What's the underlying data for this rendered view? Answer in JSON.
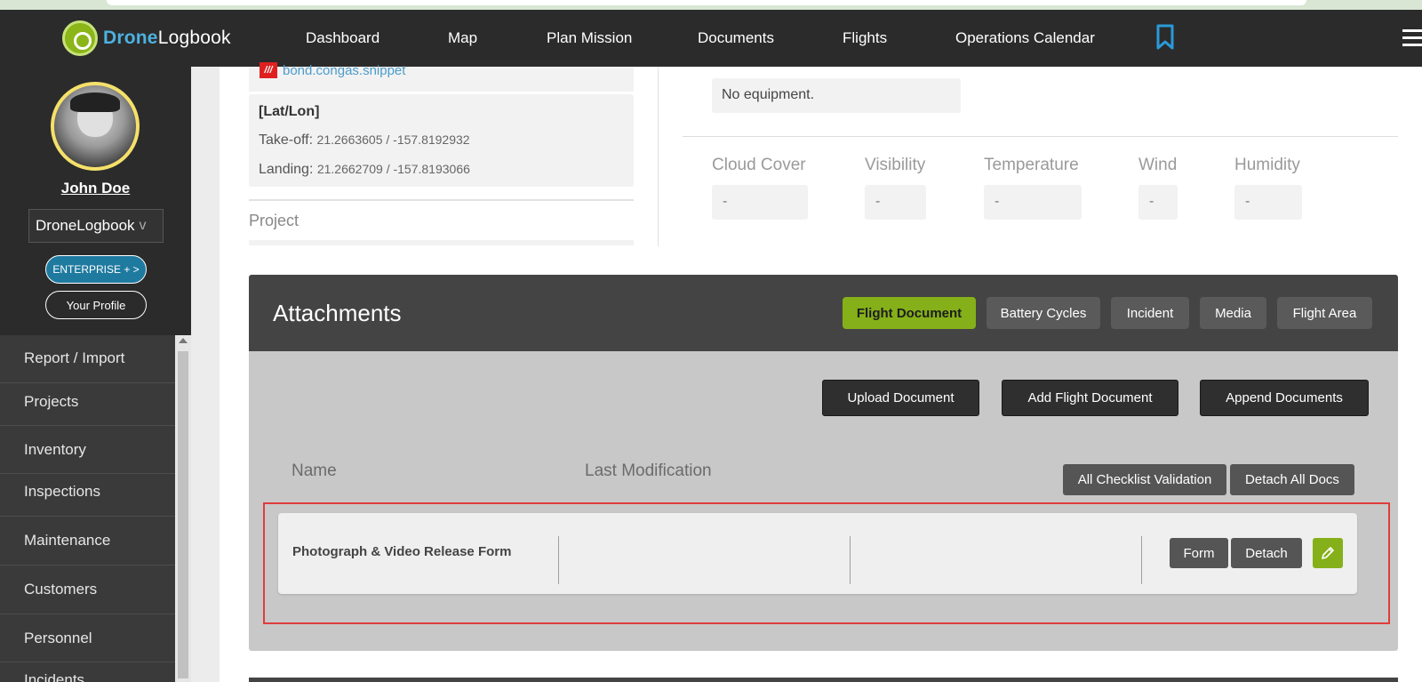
{
  "app": {
    "logo_part1": "Drone",
    "logo_part2": "Logbook"
  },
  "nav": {
    "items": [
      "Dashboard",
      "Map",
      "Plan Mission",
      "Documents",
      "Flights",
      "Operations Calendar"
    ]
  },
  "user": {
    "name": "John Doe",
    "org": "DroneLogbook",
    "org_chevron": "v",
    "enterprise_label": "ENTERPRISE + >",
    "profile_label": "Your Profile"
  },
  "sidebar": {
    "items": [
      "Report / Import",
      "Projects",
      "Inventory",
      "Inspections",
      "Maintenance",
      "Customers",
      "Personnel",
      "Incidents"
    ]
  },
  "flight": {
    "file_icon": "///",
    "file_name": "bond.congas.snippet",
    "latlon_title": "[Lat/Lon]",
    "takeoff_label": "Take-off:",
    "takeoff_value": "21.2663605 / -157.8192932",
    "landing_label": "Landing:",
    "landing_value": "21.2662709 / -157.8193066",
    "project_label": "Project",
    "equipment": "No equipment."
  },
  "weather": {
    "cloud_cover": {
      "label": "Cloud Cover",
      "value": "-"
    },
    "visibility": {
      "label": "Visibility",
      "value": "-"
    },
    "temperature": {
      "label": "Temperature",
      "value": "-"
    },
    "wind": {
      "label": "Wind",
      "value": "-"
    },
    "humidity": {
      "label": "Humidity",
      "value": "-"
    }
  },
  "attachments": {
    "title": "Attachments",
    "tabs": [
      "Flight Document",
      "Battery Cycles",
      "Incident",
      "Media",
      "Flight Area"
    ],
    "active_tab": "Flight Document",
    "actions": {
      "upload": "Upload Document",
      "add": "Add Flight Document",
      "append": "Append Documents"
    },
    "columns": {
      "name": "Name",
      "last_mod": "Last Modification"
    },
    "bulk": {
      "validate": "All Checklist Validation",
      "detach_all": "Detach All Docs"
    },
    "rows": [
      {
        "name": "Photograph & Video Release Form",
        "form_label": "Form",
        "detach_label": "Detach"
      }
    ]
  },
  "colors": {
    "nav_bg": "#2b2b2b",
    "accent_green": "#85b019",
    "accent_blue": "#1f7aa0",
    "highlight_red": "#e03c3c"
  }
}
